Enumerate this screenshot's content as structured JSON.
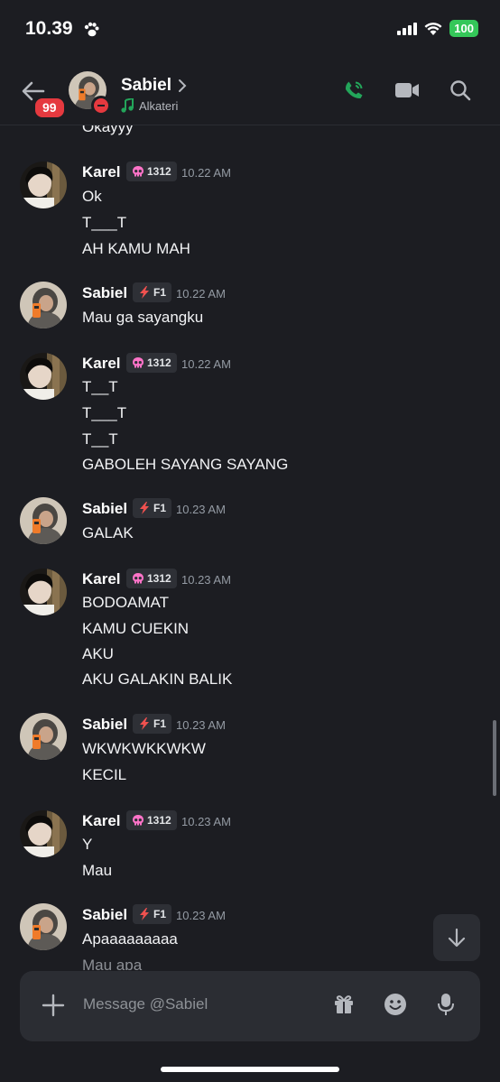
{
  "status_bar": {
    "time": "10.39",
    "battery": "100"
  },
  "header": {
    "unread_count": "99",
    "name": "Sabiel",
    "activity": "Alkateri"
  },
  "users": {
    "karel": {
      "name": "Karel",
      "tag": "1312"
    },
    "sabiel": {
      "name": "Sabiel",
      "tag": "F1"
    }
  },
  "messages": [
    {
      "lines": [
        "Okayyy"
      ]
    },
    {
      "author": "Karel",
      "time": "10.22 AM",
      "lines": [
        "Ok",
        "T___T",
        "AH KAMU MAH"
      ]
    },
    {
      "author": "Sabiel",
      "time": "10.22 AM",
      "lines": [
        "Mau ga sayangku"
      ]
    },
    {
      "author": "Karel",
      "time": "10.22 AM",
      "lines": [
        "T__T",
        "T___T",
        "T__T",
        "GABOLEH SAYANG SAYANG"
      ]
    },
    {
      "author": "Sabiel",
      "time": "10.23 AM",
      "lines": [
        "GALAK"
      ]
    },
    {
      "author": "Karel",
      "time": "10.23 AM",
      "lines": [
        "BODOAMAT",
        "KAMU CUEKIN",
        "AKU",
        "AKU GALAKIN BALIK"
      ]
    },
    {
      "author": "Sabiel",
      "time": "10.23 AM",
      "lines": [
        "WKWKWKKWKW",
        "KECIL"
      ]
    },
    {
      "author": "Karel",
      "time": "10.23 AM",
      "lines": [
        "Y",
        "Mau"
      ]
    },
    {
      "author": "Sabiel",
      "time": "10.23 AM",
      "lines": [
        "Apaaaaaaaaa",
        "Mau apa"
      ]
    }
  ],
  "composer": {
    "placeholder": "Message @Sabiel"
  },
  "colors": {
    "background": "#1c1d22",
    "accent_green": "#23a55a",
    "badge_red": "#e5393f",
    "skull_pink": "#ff73c8",
    "bolt_red": "#f0514f"
  },
  "icons": [
    "back-arrow-icon",
    "call-icon",
    "video-icon",
    "search-icon",
    "plus-icon",
    "gift-icon",
    "emoji-icon",
    "mic-icon",
    "arrow-down-icon",
    "skull-icon",
    "bolt-icon",
    "music-note-icon"
  ]
}
